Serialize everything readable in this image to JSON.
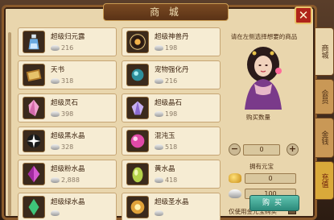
{
  "window": {
    "title": "商 城",
    "close_label": "✕"
  },
  "items": [
    {
      "name": "超级归元露",
      "price": "216",
      "icon": "blue-potion-icon"
    },
    {
      "name": "超级神兽丹",
      "price": "198",
      "icon": "beast-pill-icon"
    },
    {
      "name": "天书",
      "price": "318",
      "icon": "heavenly-book-icon"
    },
    {
      "name": "宠物强化丹",
      "price": "216",
      "icon": "pet-pill-icon"
    },
    {
      "name": "超级灵石",
      "price": "398",
      "icon": "pink-crystal-icon"
    },
    {
      "name": "超级晶石",
      "price": "198",
      "icon": "purple-gem-icon"
    },
    {
      "name": "超级黑水晶",
      "price": "328",
      "icon": "black-crystal-icon"
    },
    {
      "name": "混沌玉",
      "price": "518",
      "icon": "chaos-jade-icon"
    },
    {
      "name": "超级粉水晶",
      "price": "2,888",
      "icon": "pink-crystal-shard-icon"
    },
    {
      "name": "黄水晶",
      "price": "418",
      "icon": "yellow-crystal-icon"
    },
    {
      "name": "超级绿水晶",
      "price": "",
      "icon": "green-crystal-icon"
    },
    {
      "name": "超级圣水晶",
      "price": "",
      "icon": "holy-crystal-icon"
    }
  ],
  "detail": {
    "hint": "请在左侧选择想要的商品",
    "quantity_label": "购买数量",
    "quantity_value": "0",
    "minus": "−",
    "plus": "+",
    "owned_label": "拥有元宝",
    "gold_value": "0",
    "silver_value": "100",
    "gold_only_label": "仅使用金元宝购买",
    "buy_label": "购买"
  },
  "tabs": [
    {
      "label": "商城",
      "active": true
    },
    {
      "label": "会员",
      "active": false
    },
    {
      "label": "金钱",
      "active": false
    },
    {
      "label": "充值",
      "active": false
    }
  ],
  "colors": {
    "frame": "#e9d6ad",
    "border": "#8a5a2c",
    "close": "#b0241a",
    "buy": "#2c8a7a"
  }
}
